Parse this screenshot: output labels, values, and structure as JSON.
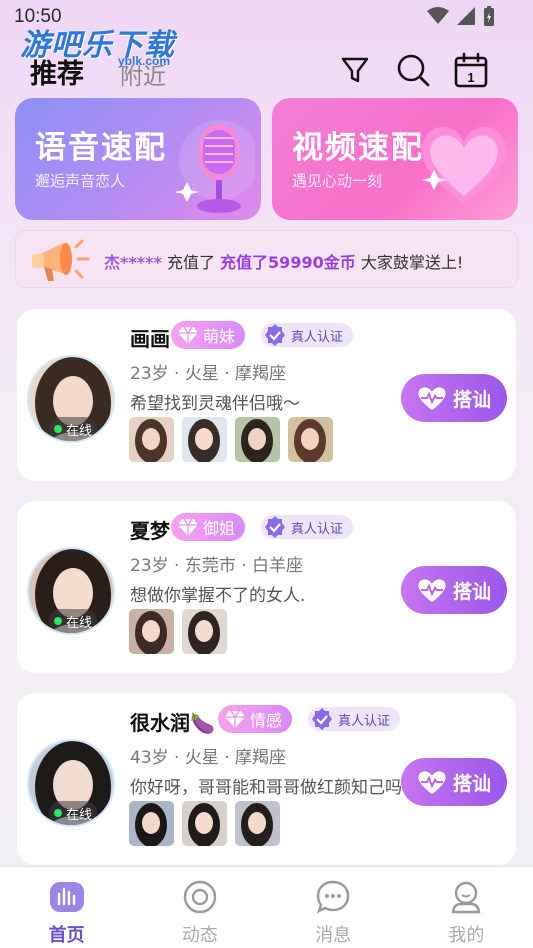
{
  "status_bar": {
    "time": "10:50"
  },
  "watermark": {
    "text": "游吧乐下载",
    "sub": "yblk.com"
  },
  "header": {
    "tabs": [
      {
        "label": "推荐",
        "active": true
      },
      {
        "label": "附近",
        "active": false
      }
    ],
    "icons": [
      "filter-icon",
      "search-icon",
      "calendar-icon"
    ],
    "calendar_day": "1"
  },
  "banners": [
    {
      "title": "语音速配",
      "subtitle": "邂逅声音恋人"
    },
    {
      "title": "视频速配",
      "subtitle": "遇见心动一刻"
    }
  ],
  "notice": {
    "user": "杰*****",
    "prefix": "充值了",
    "amount": "充值了59990金币",
    "suffix": "大家鼓掌送上!"
  },
  "users": [
    {
      "name": "画画",
      "tag": "萌妹",
      "verify": "真人认证",
      "meta": "23岁 · 火星 · 摩羯座",
      "motto": "希望找到灵魂伴侣哦～",
      "status": "在线",
      "photo_count": 4,
      "action": "搭讪"
    },
    {
      "name": "夏梦",
      "tag": "御姐",
      "verify": "真人认证",
      "meta": "23岁 · 东莞市 · 白羊座",
      "motto": "想做你掌握不了的女人.",
      "status": "在线",
      "photo_count": 2,
      "action": "搭讪"
    },
    {
      "name": "很水润🍆",
      "tag": "情感",
      "verify": "真人认证",
      "meta": "43岁 · 火星 · 摩羯座",
      "motto": "你好呀，哥哥能和哥哥做红颜知己吗",
      "status": "在线",
      "photo_count": 3,
      "action": "搭讪"
    }
  ],
  "bottom_nav": [
    {
      "label": "首页",
      "icon": "home-icon",
      "active": true
    },
    {
      "label": "动态",
      "icon": "moments-icon",
      "active": false
    },
    {
      "label": "消息",
      "icon": "message-icon",
      "active": false
    },
    {
      "label": "我的",
      "icon": "profile-icon",
      "active": false
    }
  ],
  "colors": {
    "accent": "#9b57e8",
    "active_nav": "#6a50c8",
    "online": "#2ee36a"
  }
}
